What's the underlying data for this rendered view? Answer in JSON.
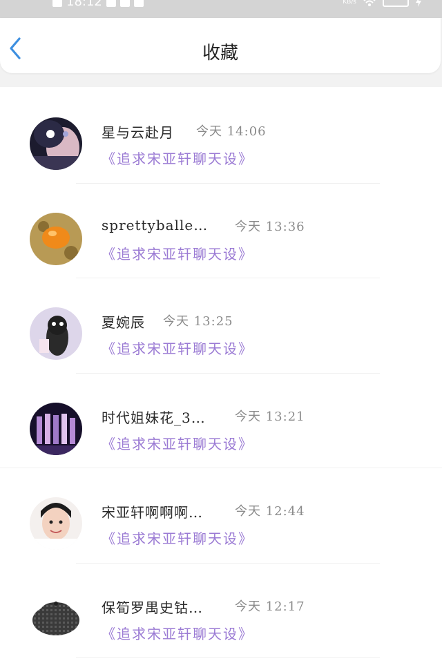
{
  "statusbar": {
    "time": "18:12",
    "network_speed": "KB/s"
  },
  "header": {
    "title": "收藏",
    "back_icon": "chevron-left-icon",
    "accent": "#3d8fe0"
  },
  "items": [
    {
      "name": "星与云赴月",
      "time": "今天 14:06",
      "link": "《追求宋亚轩聊天设》",
      "avatar": "anime-girl"
    },
    {
      "name": "sprettyballe…",
      "time": "今天 13:36",
      "link": "《追求宋亚轩聊天设》",
      "avatar": "egg-yolk"
    },
    {
      "name": "夏婉辰",
      "time": "今天 13:25",
      "link": "《追求宋亚轩聊天设》",
      "avatar": "doll"
    },
    {
      "name": "时代姐妹花_3…",
      "time": "今天 13:21",
      "link": "《追求宋亚轩聊天设》",
      "avatar": "group-stage"
    },
    {
      "name": "宋亚轩啊啊啊…",
      "time": "今天 12:44",
      "link": "《追求宋亚轩聊天设》",
      "avatar": "boy-portrait"
    },
    {
      "name": "保筍罗禺史钴…",
      "time": "今天 12:17",
      "link": "《追求宋亚轩聊天设》",
      "avatar": "plaid-hat"
    }
  ],
  "colors": {
    "link": "#9b7bd4",
    "time": "#8a8a8a",
    "name": "#2a2a2a"
  }
}
